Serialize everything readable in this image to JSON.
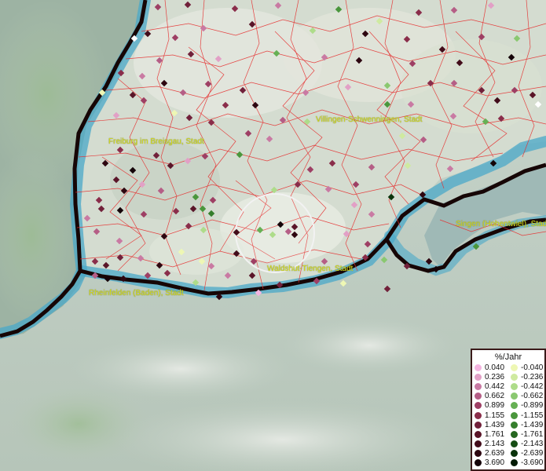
{
  "cities": {
    "villingen": "Villingen-Schwenningen, Stadt",
    "freiburg": "Freiburg im Breisgau, Stadt",
    "singen": "Singen (Hohentwiel), Stadt",
    "waldshut": "Waldshut-Tiengen, Stadt",
    "rheinfelden": "Rheinfelden (Baden), Stadt"
  },
  "legend": {
    "title": "%/Jahr",
    "positive": [
      {
        "label": "0.040",
        "color": "#f4b4e0"
      },
      {
        "label": "0.236",
        "color": "#e2a0c6"
      },
      {
        "label": "0.442",
        "color": "#c97aa3"
      },
      {
        "label": "0.662",
        "color": "#b55e86"
      },
      {
        "label": "0.899",
        "color": "#9e3f64"
      },
      {
        "label": "1.155",
        "color": "#8a2d4a"
      },
      {
        "label": "1.439",
        "color": "#71203a"
      },
      {
        "label": "1.761",
        "color": "#5a1528"
      },
      {
        "label": "2.143",
        "color": "#420c1a"
      },
      {
        "label": "2.639",
        "color": "#2d0610"
      },
      {
        "label": "3.690",
        "color": "#140308"
      }
    ],
    "negative": [
      {
        "label": "-0.040",
        "color": "#eef7b4"
      },
      {
        "label": "-0.236",
        "color": "#cfeaa0"
      },
      {
        "label": "-0.442",
        "color": "#aedc8a"
      },
      {
        "label": "-0.662",
        "color": "#8ac870"
      },
      {
        "label": "-0.899",
        "color": "#66b054"
      },
      {
        "label": "-1.155",
        "color": "#4a963c"
      },
      {
        "label": "-1.439",
        "color": "#357e2c"
      },
      {
        "label": "-1.761",
        "color": "#25661f"
      },
      {
        "label": "-2.143",
        "color": "#154d14"
      },
      {
        "label": "-2.639",
        "color": "#0a330b"
      },
      {
        "label": "-3.690",
        "color": "#031a04"
      }
    ]
  },
  "colors": {
    "border": "#e53030",
    "rhine": "#4aa8c8",
    "lake": "#1f6e86"
  }
}
